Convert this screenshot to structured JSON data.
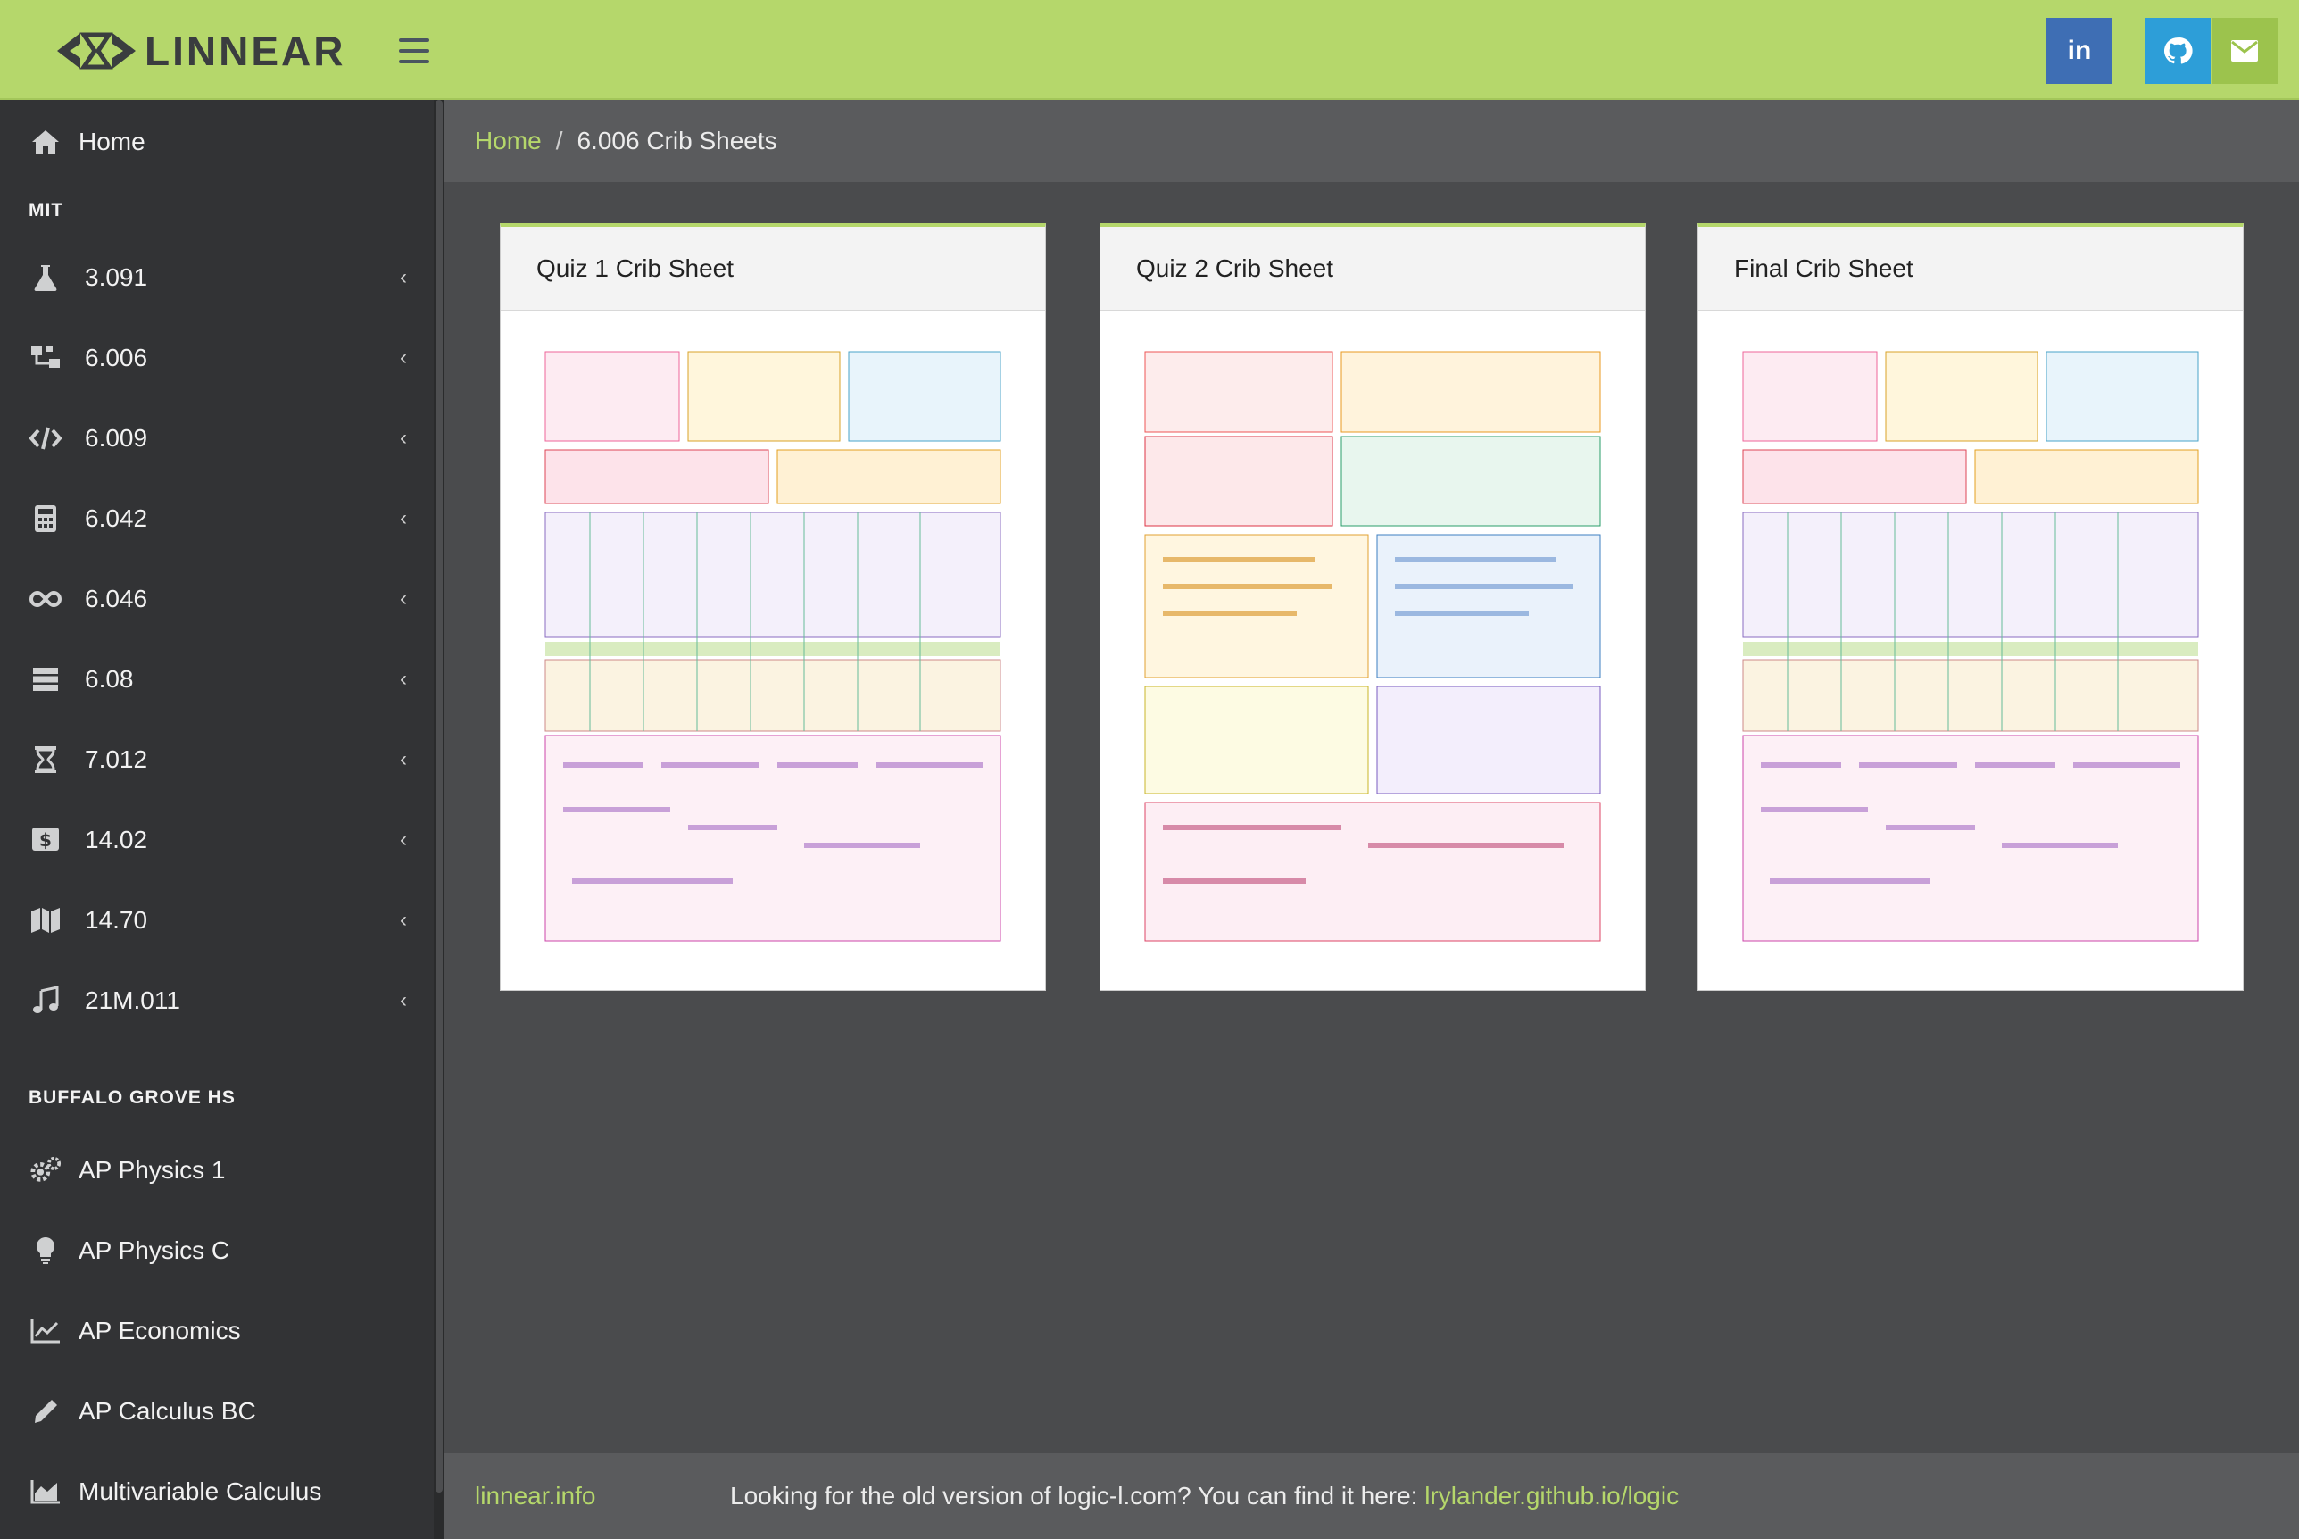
{
  "header": {
    "brand": "LINNEAR",
    "social": [
      {
        "icon": "linkedin-icon",
        "label": "in",
        "color": "#3e6eb4"
      },
      {
        "icon": "github-icon",
        "label": "",
        "color": "#2d9ed8"
      },
      {
        "icon": "email-icon",
        "label": "",
        "color": "#9cc34d"
      }
    ]
  },
  "sidebar": {
    "home": {
      "label": "Home",
      "icon": "home-icon"
    },
    "sections": [
      {
        "title": "MIT",
        "items": [
          {
            "label": "3.091",
            "icon": "flask-icon"
          },
          {
            "label": "6.006",
            "icon": "sitemap-icon"
          },
          {
            "label": "6.009",
            "icon": "code-icon"
          },
          {
            "label": "6.042",
            "icon": "calculator-icon"
          },
          {
            "label": "6.046",
            "icon": "infinity-icon"
          },
          {
            "label": "6.08",
            "icon": "server-icon"
          },
          {
            "label": "7.012",
            "icon": "hourglass-icon"
          },
          {
            "label": "14.02",
            "icon": "dollar-icon"
          },
          {
            "label": "14.70",
            "icon": "map-icon"
          },
          {
            "label": "21M.011",
            "icon": "music-icon"
          }
        ]
      },
      {
        "title": "BUFFALO GROVE HS",
        "items": [
          {
            "label": "AP Physics 1",
            "icon": "cogs-icon"
          },
          {
            "label": "AP Physics C",
            "icon": "lightbulb-icon"
          },
          {
            "label": "AP Economics",
            "icon": "line-chart-icon"
          },
          {
            "label": "AP Calculus BC",
            "icon": "pencil-icon"
          },
          {
            "label": "Multivariable Calculus",
            "icon": "area-chart-icon"
          }
        ]
      }
    ]
  },
  "breadcrumb": {
    "home": "Home",
    "separator": "/",
    "current": "6.006 Crib Sheets"
  },
  "cards": [
    {
      "title": "Quiz 1 Crib Sheet"
    },
    {
      "title": "Quiz 2 Crib Sheet"
    },
    {
      "title": "Final Crib Sheet"
    }
  ],
  "footer": {
    "site": "linnear.info",
    "message": "Looking for the old version of logic-l.com? You can find it here: ",
    "link": "lrylander.github.io/logic"
  },
  "colors": {
    "accent": "#b5d76b",
    "sidebar": "#323335",
    "content": "#4a4b4d"
  }
}
